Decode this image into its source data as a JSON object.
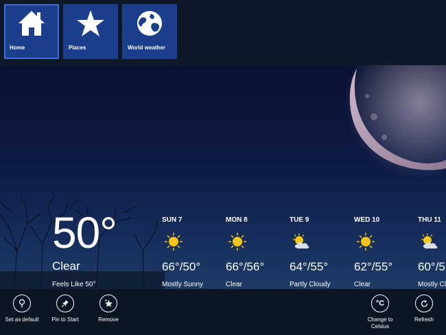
{
  "nav": {
    "tiles": [
      {
        "label": "Home",
        "icon": "home-icon"
      },
      {
        "label": "Places",
        "icon": "star-icon"
      },
      {
        "label": "World weather",
        "icon": "globe-icon"
      }
    ]
  },
  "current": {
    "temperature": "50°",
    "condition": "Clear",
    "feels_like": "Feels Like 50°"
  },
  "forecast": [
    {
      "day": "SUN 7",
      "icon": "sun-icon",
      "temps": "66°/50°",
      "desc": "Mostly Sunny"
    },
    {
      "day": "MON 8",
      "icon": "sun-icon",
      "temps": "66°/56°",
      "desc": "Clear"
    },
    {
      "day": "TUE 9",
      "icon": "partly-cloudy-icon",
      "temps": "64°/55°",
      "desc": "Partly Cloudy"
    },
    {
      "day": "WED 10",
      "icon": "sun-icon",
      "temps": "62°/55°",
      "desc": "Clear"
    },
    {
      "day": "THU 11",
      "icon": "partly-cloudy-icon",
      "temps": "60°/5",
      "desc": "Mostly Cl"
    }
  ],
  "appbar": {
    "set_default": "Set as default",
    "pin_start": "Pin to Start",
    "remove": "Remove",
    "change_unit": "Change to Celsius",
    "change_unit_glyph": "°C",
    "refresh": "Refresh"
  },
  "colors": {
    "tile": "#1b3f8a",
    "sun": "#f5c518",
    "appbar": "#0c1524"
  }
}
